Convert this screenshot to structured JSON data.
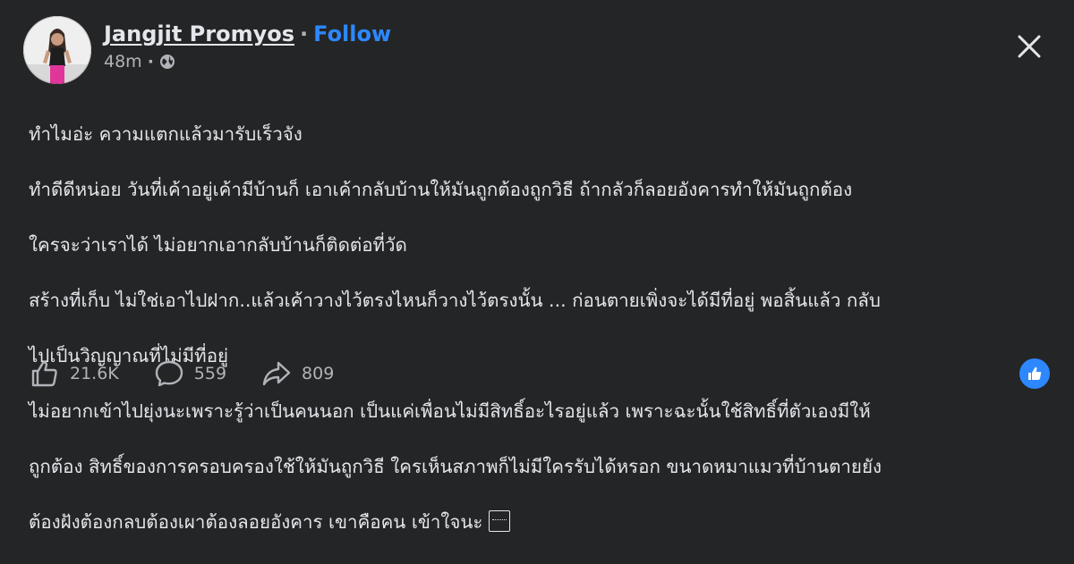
{
  "post": {
    "author": "Jangjit Promyos",
    "separator": "·",
    "follow_label": "Follow",
    "timestamp": "48m",
    "dot": "·",
    "audience_icon": "globe-icon",
    "paragraphs": [
      "ทำไมอ่ะ ความแตกแล้วมารับเร็วจัง",
      " ทำดีดีหน่อย วันที่เค้าอยู่เค้ามีบ้านก็ เอาเค้ากลับบ้านให้มันถูกต้องถูกวิธี ถ้ากลัวก็ลอยอังคารทำให้มันถูกต้อง",
      "ใครจะว่าเราได้ ไม่อยากเอากลับบ้านก็ติดต่อที่วัด",
      "สร้างที่เก็บ ไม่ใช่เอาไปฝาก..แล้วเค้าวางไว้ตรงไหนก็วางไว้ตรงนั้น ... ก่อนตายเพิ่งจะได้มีที่อยู่ พอสิ้นแล้ว กลับ",
      "ไปเป็นวิญญาณที่ไม่มีที่อยู่",
      "ไม่อยากเข้าไปยุ่งนะเพราะรู้ว่าเป็นคนนอก เป็นแค่เพื่อนไม่มีสิทธิ์อะไรอยู่แล้ว เพราะฉะนั้นใช้สิทธิ์ที่ตัวเองมีให้",
      "ถูกต้อง สิทธิ์ของการครอบครองใช้ให้มันถูกวิธี ใครเห็นสภาพก็ไม่มีใครรับได้หรอก ขนาดหมาแมวที่บ้านตายยัง",
      "ต้องฝังต้องกลบต้องเผาต้องลอยอังคาร เขาคือคน เข้าใจนะ "
    ],
    "reactions": {
      "likes": "21.6K",
      "comments": "559",
      "shares": "809"
    }
  },
  "colors": {
    "background": "#242526",
    "text": "#e4e6eb",
    "muted": "#b0b3b8",
    "accent": "#2d88ff"
  }
}
